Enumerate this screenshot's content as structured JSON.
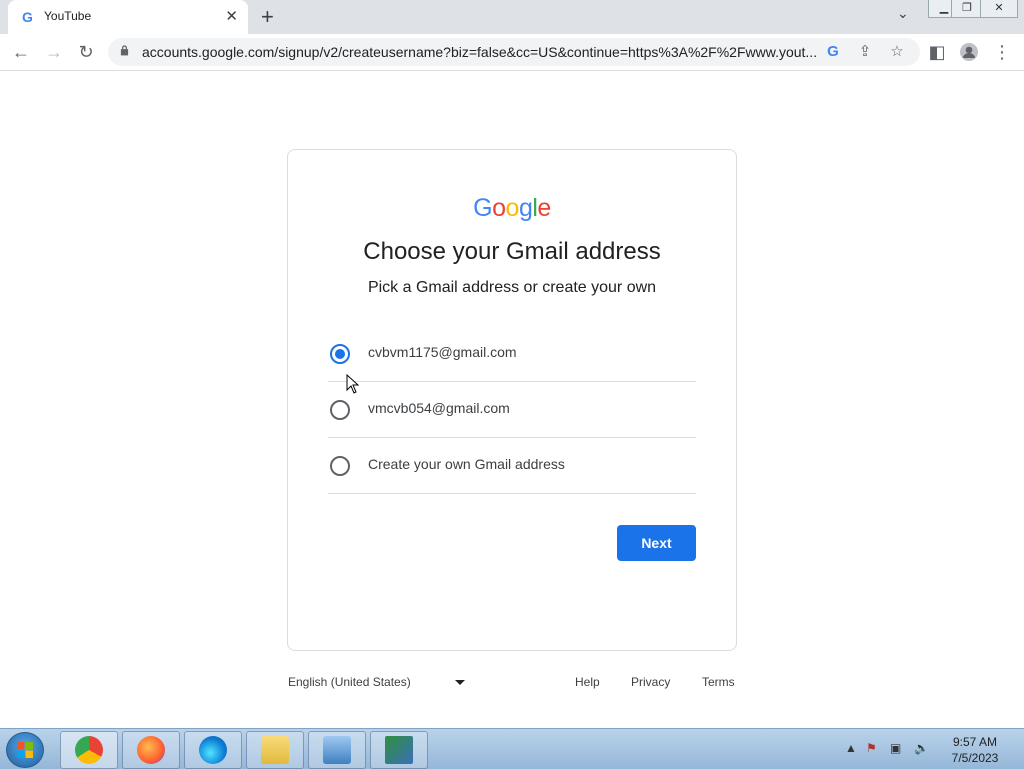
{
  "browser": {
    "tab_title": "YouTube",
    "tab_favicon": "G",
    "new_tab": "+",
    "url": "accounts.google.com/signup/v2/createusername?biz=false&cc=US&continue=https%3A%2F%2Fwww.yout..."
  },
  "page": {
    "logo": [
      "G",
      "o",
      "o",
      "g",
      "l",
      "e"
    ],
    "title": "Choose your Gmail address",
    "subtitle": "Pick a Gmail address or create your own",
    "options": [
      {
        "label": "cvbvm1175@gmail.com",
        "selected": true
      },
      {
        "label": "vmcvb054@gmail.com",
        "selected": false
      },
      {
        "label": "Create your own Gmail address",
        "selected": false
      }
    ],
    "next_label": "Next"
  },
  "footer": {
    "language": "English (United States)",
    "help": "Help",
    "privacy": "Privacy",
    "terms": "Terms"
  },
  "taskbar": {
    "time": "9:57 AM",
    "date": "7/5/2023"
  },
  "colors": {
    "accent": "#1a73e8",
    "google_blue": "#4285f4",
    "google_red": "#ea4335",
    "google_yellow": "#fbbc05",
    "google_green": "#34a853"
  }
}
